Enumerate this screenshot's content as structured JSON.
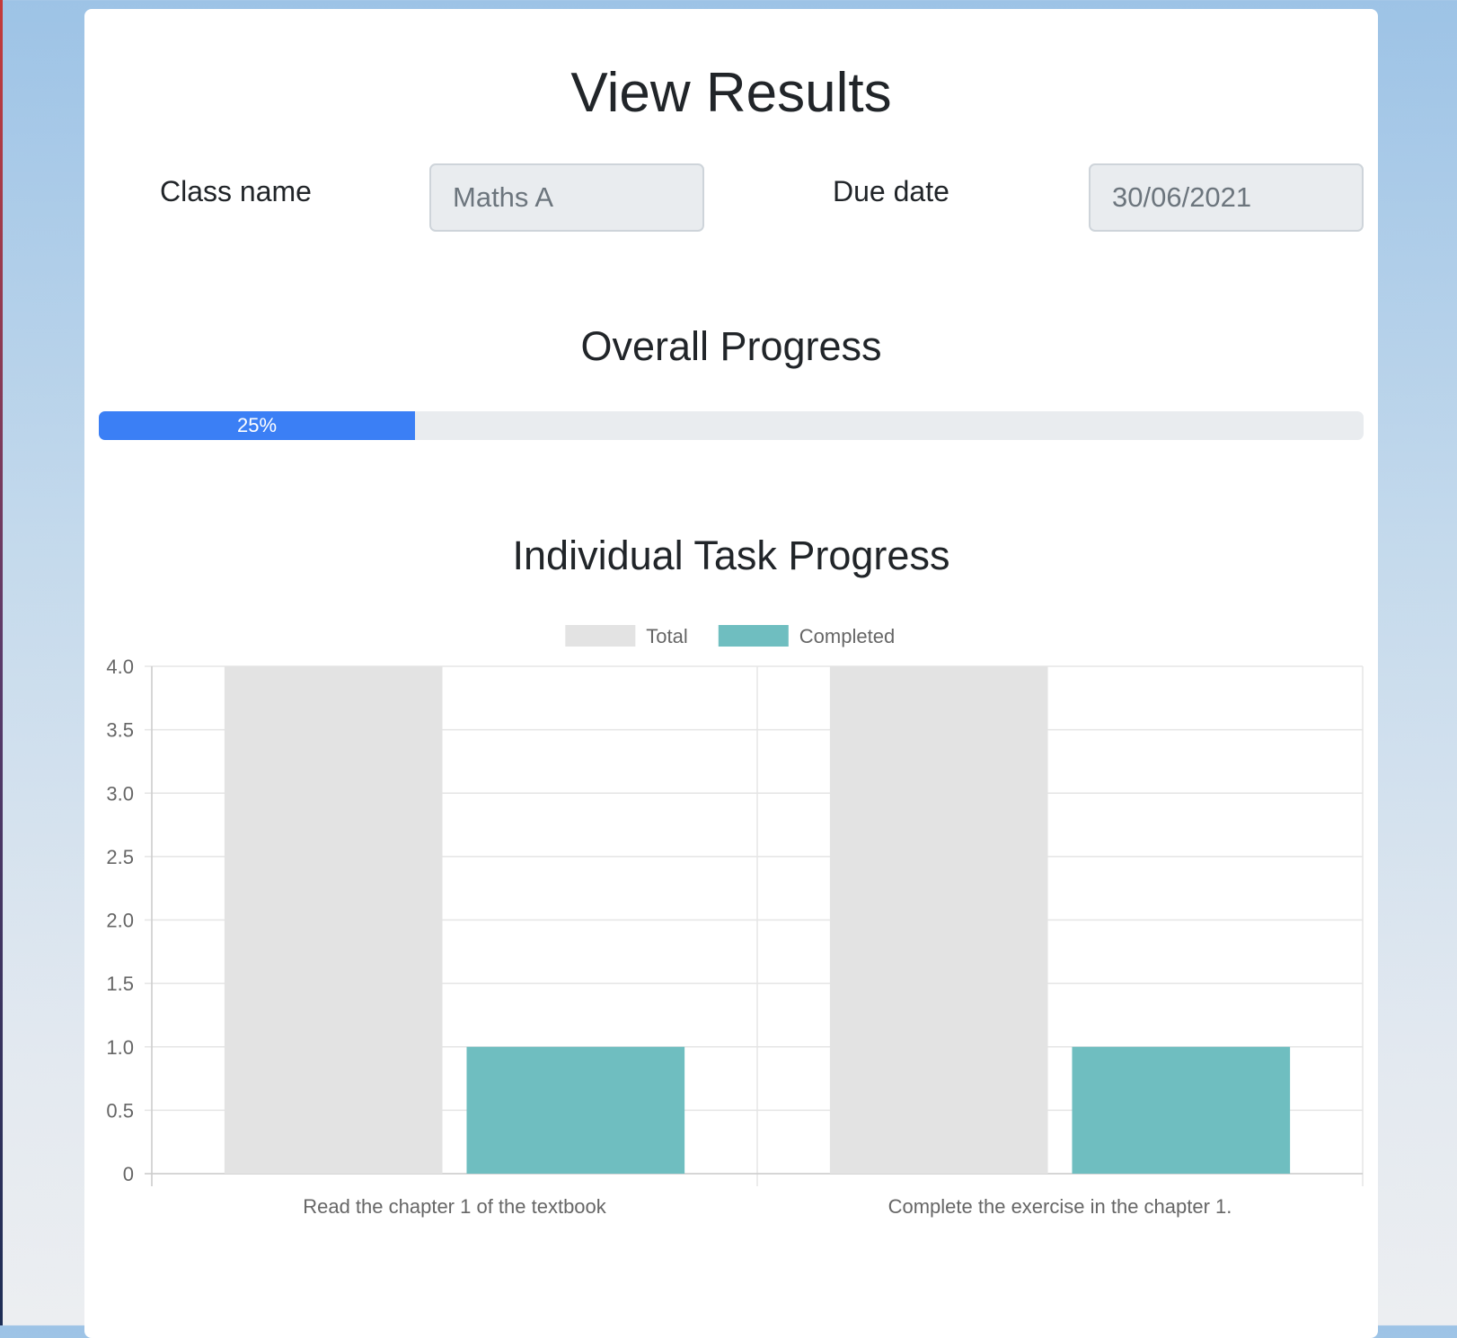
{
  "page": {
    "title": "View Results"
  },
  "form": {
    "class_name_label": "Class name",
    "class_name_value": "Maths A",
    "due_date_label": "Due date",
    "due_date_value": "30/06/2021"
  },
  "overall": {
    "title": "Overall Progress",
    "percent": 25,
    "label": "25%"
  },
  "tasks": {
    "title": "Individual Task Progress"
  },
  "chart_data": {
    "type": "bar",
    "categories": [
      "Read the chapter 1 of the textbook",
      "Complete the exercise in the chapter 1."
    ],
    "series": [
      {
        "name": "Total",
        "values": [
          4,
          4
        ],
        "color": "#e3e3e3"
      },
      {
        "name": "Completed",
        "values": [
          1,
          1
        ],
        "color": "#6fbec0"
      }
    ],
    "ylim": [
      0,
      4
    ],
    "yticks": [
      "0",
      "0.5",
      "1.0",
      "1.5",
      "2.0",
      "2.5",
      "3.0",
      "3.5",
      "4.0"
    ],
    "grid": true,
    "legend": "top-center"
  },
  "colors": {
    "progress": "#3b7ff5",
    "gridline": "#e5e5e5",
    "axis_text": "#666666"
  }
}
